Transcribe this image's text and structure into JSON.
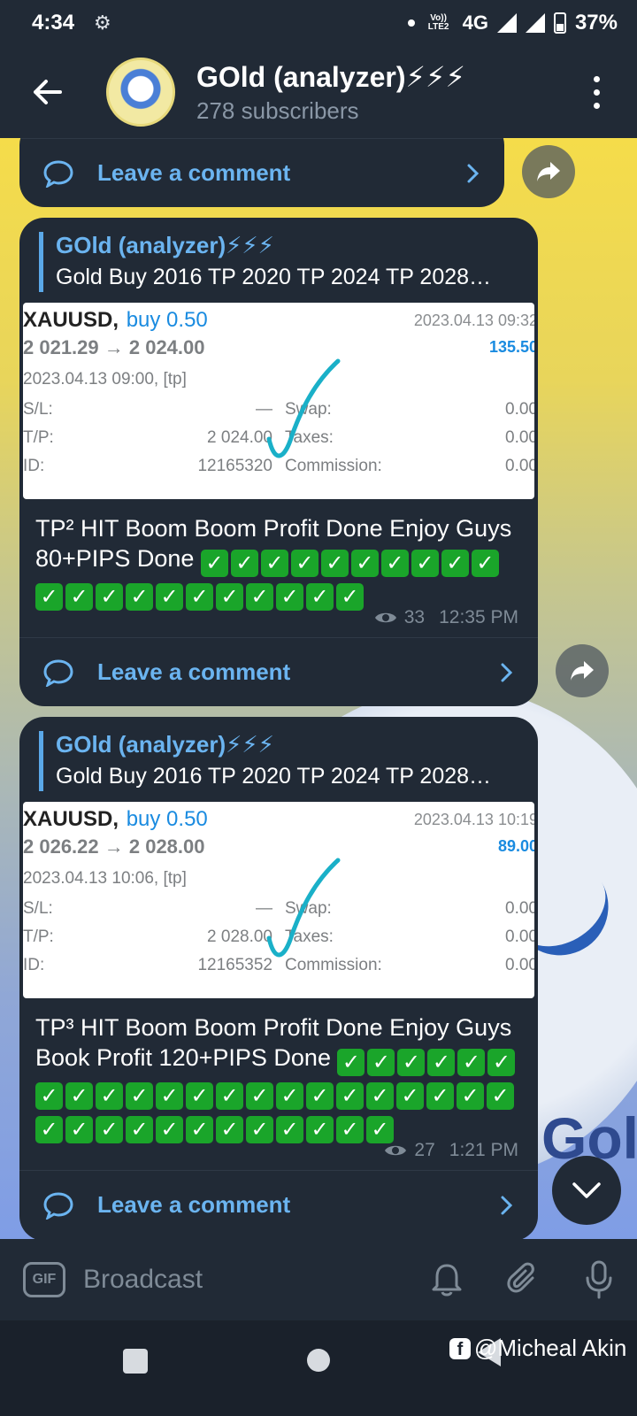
{
  "status_bar": {
    "time": "4:34",
    "network_label": "Vo)) LTE2",
    "network_type": "4G",
    "battery": "37%"
  },
  "header": {
    "channel_name": "GOld (analyzer)⚡⚡⚡",
    "subscribers": "278 subscribers"
  },
  "messages": [
    {
      "comment_label": "Leave a comment"
    },
    {
      "reply_name": "GOld (analyzer)⚡⚡⚡",
      "reply_text": "Gold Buy 2016  TP 2020  TP 2024  TP 2028…",
      "trade": {
        "symbol": "XAUUSD,",
        "side": "buy 0.50",
        "close_time": "2023.04.13 09:32",
        "prices": "2 021.29 → 2 024.00",
        "profit": "135.50",
        "open_time": "2023.04.13 09:00, [tp]",
        "sl_label": "S/L:",
        "sl_value": "—",
        "tp_label": "T/P:",
        "tp_value": "2 024.00",
        "id_label": "ID:",
        "id_value": "12165320",
        "swap_label": "Swap:",
        "swap_value": "0.00",
        "taxes_label": "Taxes:",
        "taxes_value": "0.00",
        "commission_label": "Commission:",
        "commission_value": "0.00"
      },
      "text": "TP² HIT Boom Boom Profit Done Enjoy Guys 80+PIPS Done",
      "check_count": 21,
      "views": "33",
      "time": "12:35 PM",
      "comment_label": "Leave a comment"
    },
    {
      "reply_name": "GOld (analyzer)⚡⚡⚡",
      "reply_text": "Gold Buy 2016  TP 2020  TP 2024  TP 2028…",
      "trade": {
        "symbol": "XAUUSD,",
        "side": "buy 0.50",
        "close_time": "2023.04.13 10:19",
        "prices": "2 026.22 → 2 028.00",
        "profit": "89.00",
        "open_time": "2023.04.13 10:06, [tp]",
        "sl_label": "S/L:",
        "sl_value": "—",
        "tp_label": "T/P:",
        "tp_value": "2 028.00",
        "id_label": "ID:",
        "id_value": "12165352",
        "swap_label": "Swap:",
        "swap_value": "0.00",
        "taxes_label": "Taxes:",
        "taxes_value": "0.00",
        "commission_label": "Commission:",
        "commission_value": "0.00"
      },
      "text": "TP³ HIT Boom Boom Profit Done Enjoy Guys Book Profit 120+PIPS Done",
      "check_count": 34,
      "views": "27",
      "time": "1:21 PM",
      "comment_label": "Leave a comment"
    }
  ],
  "input_bar": {
    "gif_label": "GIF",
    "placeholder": "Broadcast"
  },
  "watermark": "@Micheal Akin",
  "colors": {
    "accent": "#6bb4f0",
    "bubble": "#212a36",
    "check": "#1aa52a"
  }
}
